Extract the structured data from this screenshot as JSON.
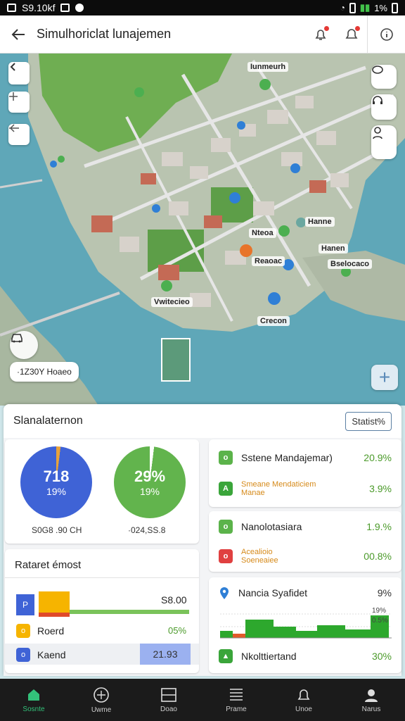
{
  "status_bar": {
    "left_text": "S9.10kf",
    "right_text": "1%"
  },
  "app_bar": {
    "title": "Simulhoriclat lunajemen"
  },
  "map": {
    "labels": [
      "Iunmeurh",
      "Nteoa",
      "Hanne",
      "Hanen",
      "Reaoac",
      "Bselocaco",
      "Vwitecieo",
      "Crecon"
    ],
    "chip_text": "·1Z30Y Hoaeo",
    "colors": {
      "water": "#5fa7b8",
      "land": "#b9c4b0",
      "park": "#6fae52"
    }
  },
  "sheet": {
    "title": "Slanalaternon",
    "stat_button": "Statist%",
    "gauges": [
      {
        "big": "718",
        "small": "19%",
        "value": "S0G8 .90 CH",
        "color": "#3f63d6",
        "fill_fraction": 0.02
      },
      {
        "big": "29%",
        "small": "19%",
        "value": "·024,SS.8",
        "color": "#62b44d",
        "fill_fraction": 0.98
      }
    ],
    "reports": {
      "title": "Rataret émost",
      "rows": [
        {
          "label": "",
          "value": "S8.00",
          "icon_color": "#3f63d6",
          "icon": "P"
        },
        {
          "label": "Roerd",
          "value": "05%",
          "icon_color": "#f6b400",
          "icon": "o"
        },
        {
          "label": "Kaend",
          "value": "21.93",
          "icon_color": "#3f63d6",
          "icon": "o"
        }
      ]
    },
    "list_top": [
      {
        "label": "Sstene Mandajemar)",
        "pct": "20.9%",
        "icon_color": "#5bb34a",
        "icon": "o"
      },
      {
        "label": "Smeane Mendaticiem Manae",
        "pct": "3.9%",
        "icon_color": "#3aa53a",
        "icon": "A",
        "small": true
      }
    ],
    "list_mid": [
      {
        "label": "Nanolotasiara",
        "pct": "1.9.%",
        "icon_color": "#5bb34a",
        "icon": "o"
      },
      {
        "label": "Acealioio Soeneaiee",
        "pct": "00.8%",
        "icon_color": "#e04040",
        "icon": "o",
        "small": true
      }
    ],
    "list_bot": {
      "header_label": "Nancia Syafidet",
      "header_pct": "9%",
      "chart_label1": "19%",
      "chart_label2": "0.5%",
      "footer_label": "Nkolttiertand",
      "footer_pct": "30%"
    }
  },
  "bottom_nav": [
    {
      "label": "Sosnte",
      "icon": "home-icon",
      "active": true
    },
    {
      "label": "Uwme",
      "icon": "compass-icon"
    },
    {
      "label": "Doao",
      "icon": "window-icon"
    },
    {
      "label": "Prame",
      "icon": "list-icon"
    },
    {
      "label": "Unoe",
      "icon": "bell-icon"
    },
    {
      "label": "Narus",
      "icon": "profile-icon"
    }
  ]
}
